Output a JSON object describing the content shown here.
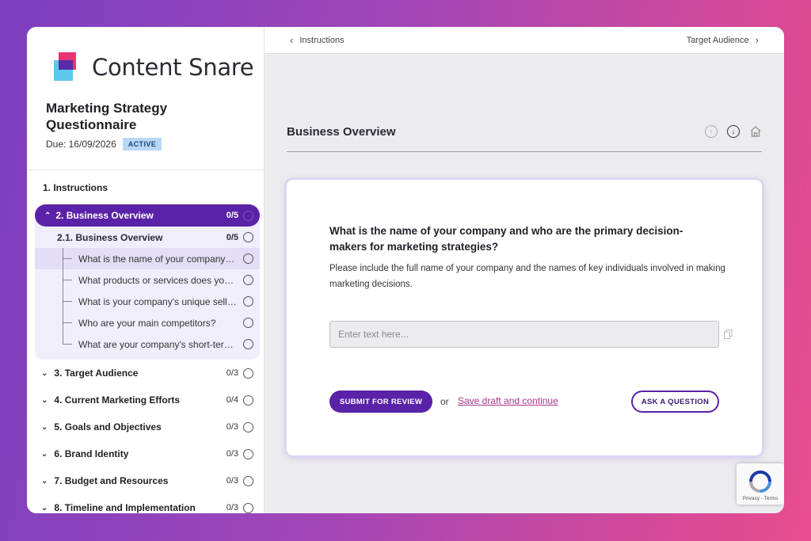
{
  "brand": {
    "name": "Content Snare"
  },
  "questionnaire": {
    "title": "Marketing Strategy Questionnaire",
    "due": "Due: 16/09/2026",
    "status": "ACTIVE"
  },
  "nav": {
    "instructions": "1. Instructions",
    "active_section": {
      "label": "2. Business Overview",
      "count": "0/5"
    },
    "subsection": {
      "label": "2.1. Business Overview",
      "count": "0/5"
    },
    "questions": [
      "What is the name of your company and who are the primary decision-makers for marketing strategies?",
      "What products or services does your company offer?",
      "What is your company's unique selling proposition?",
      "Who are your main competitors?",
      "What are your company's short-term and long-term goals?"
    ],
    "sections": [
      {
        "label": "3. Target Audience",
        "count": "0/3"
      },
      {
        "label": "4. Current Marketing Efforts",
        "count": "0/4"
      },
      {
        "label": "5. Goals and Objectives",
        "count": "0/3"
      },
      {
        "label": "6. Brand Identity",
        "count": "0/3"
      },
      {
        "label": "7. Budget and Resources",
        "count": "0/3"
      },
      {
        "label": "8. Timeline and Implementation",
        "count": "0/3"
      }
    ]
  },
  "topbar": {
    "prev": "Instructions",
    "next": "Target Audience"
  },
  "main": {
    "heading": "Business Overview",
    "question": "What is the name of your company and who are the primary decision-makers for marketing strategies?",
    "help": "Please include the full name of your company and the names of key individuals involved in making marketing decisions.",
    "input_placeholder": "Enter text here...",
    "submit_label": "SUBMIT FOR REVIEW",
    "or_label": "or",
    "draft_label": "Save draft and continue",
    "ask_label": "ASK A QUESTION"
  },
  "recaptcha": {
    "text": "Privacy - Terms"
  },
  "colors": {
    "accent": "#5a22a8",
    "link": "#a8368a",
    "badge": "#b8d7f5"
  }
}
